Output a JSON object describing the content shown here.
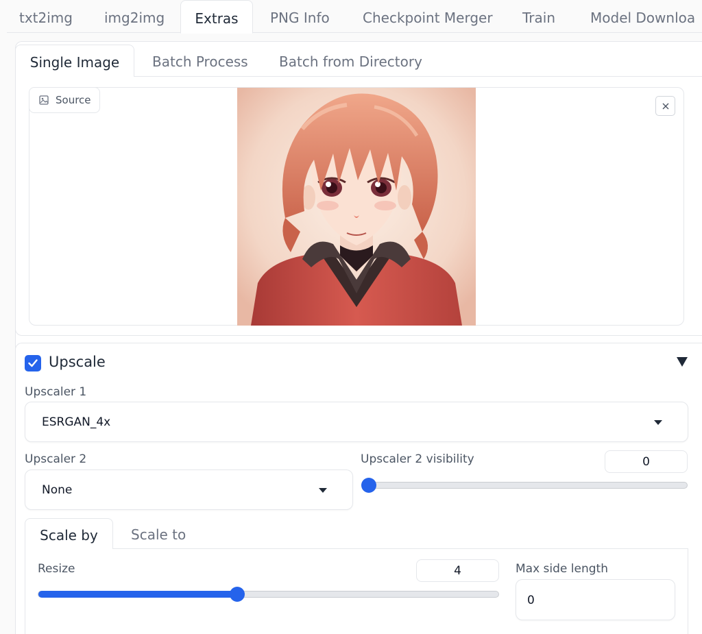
{
  "top_tabs": [
    "txt2img",
    "img2img",
    "Extras",
    "PNG Info",
    "Checkpoint Merger",
    "Train",
    "Model Downloa"
  ],
  "sub_tabs": [
    "Single Image",
    "Batch Process",
    "Batch from Directory"
  ],
  "source": {
    "label": "Source"
  },
  "upscale": {
    "title": "Upscale",
    "checked": true,
    "upscaler1": {
      "label": "Upscaler 1",
      "value": "ESRGAN_4x"
    },
    "upscaler2": {
      "label": "Upscaler 2",
      "value": "None"
    },
    "upscaler2_visibility": {
      "label": "Upscaler 2 visibility",
      "value": "0",
      "fraction": 0
    },
    "scale_tabs": [
      "Scale by",
      "Scale to"
    ],
    "resize": {
      "label": "Resize",
      "value": "4",
      "fraction": 0.43
    },
    "max_side_length": {
      "label": "Max side length",
      "value": "0"
    }
  },
  "colors": {
    "accent": "#2563eb"
  }
}
